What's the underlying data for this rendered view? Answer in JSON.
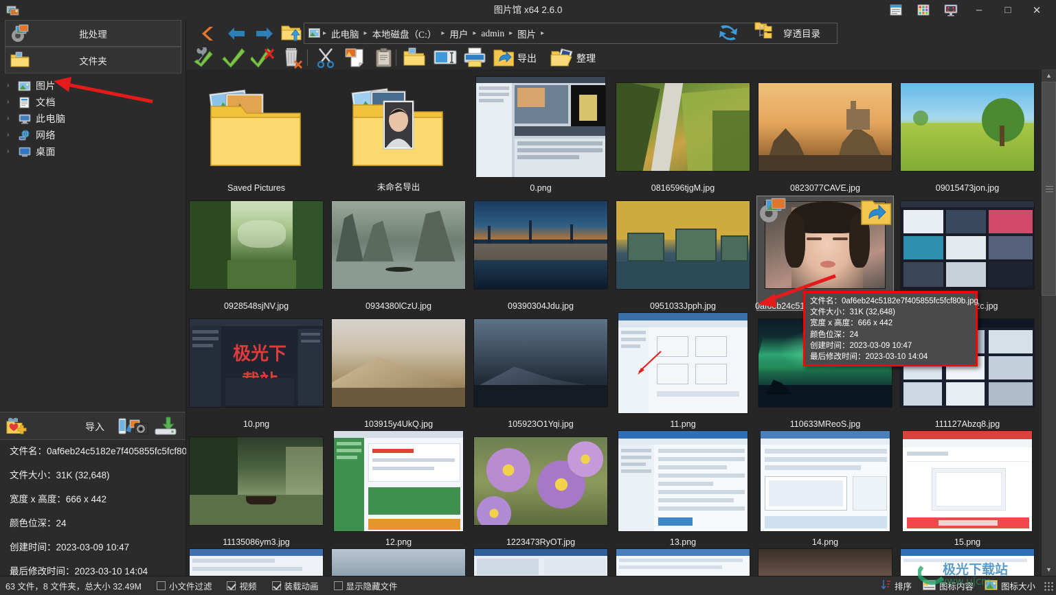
{
  "window": {
    "title": "图片馆 x64 2.6.0",
    "app_icon": "photo-library-icon",
    "tray_icons": [
      "document-list-icon",
      "color-palette-icon",
      "screen-capture-icon"
    ],
    "minimize": "–",
    "maximize": "□",
    "close": "✕"
  },
  "left_panel": {
    "batch_label": "批处理",
    "folder_label": "文件夹",
    "tree": [
      {
        "label": "图片",
        "icon": "picture-icon",
        "chevron": "›"
      },
      {
        "label": "文档",
        "icon": "document-icon",
        "chevron": "›"
      },
      {
        "label": "此电脑",
        "icon": "computer-icon",
        "chevron": "›"
      },
      {
        "label": "网络",
        "icon": "network-icon",
        "chevron": "›"
      },
      {
        "label": "桌面",
        "icon": "desktop-icon",
        "chevron": "›"
      }
    ],
    "import_label": "导入",
    "import_icons": [
      "favorites-add-icon",
      "camera-import-icon",
      "disk-import-icon"
    ],
    "info": [
      "文件名：0af6eb24c5182e7f405855fc5fcf80",
      "文件大小：31K (32,648)",
      "宽度 x 高度：666 x 442",
      "颜色位深：24",
      "创建时间：2023-03-09 10:47",
      "最后修改时间：2023-03-10 14:04"
    ]
  },
  "toolbar": {
    "nav": [
      {
        "name": "back-up-icon",
        "glyph": "‹"
      },
      {
        "name": "back-arrow-icon",
        "glyph": "←"
      },
      {
        "name": "forward-arrow-icon",
        "glyph": "→"
      },
      {
        "name": "open-parent-folder-icon",
        "glyph": "↑"
      }
    ],
    "address": {
      "icon": "picture-icon",
      "crumbs": [
        "此电脑",
        "本地磁盘（C:）",
        "用户",
        "admin",
        "图片"
      ],
      "separator": "▸"
    },
    "refresh_icon": "refresh-icon",
    "passthrough_label": "穿透目录",
    "passthrough_icon": "folder-tree-icon",
    "collapse_icon": "collapse-chevron-icon",
    "tools": [
      {
        "name": "settings-check-icon"
      },
      {
        "name": "select-all-icon"
      },
      {
        "name": "deselect-icon"
      },
      {
        "name": "delete-icon"
      },
      {
        "name": "cut-icon"
      },
      {
        "name": "copy-icon"
      },
      {
        "name": "paste-icon"
      },
      {
        "name": "new-folder-icon"
      },
      {
        "name": "rename-icon"
      },
      {
        "name": "print-icon"
      }
    ],
    "export_label": "导出",
    "export_icon": "export-folder-icon",
    "organize_label": "整理",
    "organize_icon": "organize-folder-icon"
  },
  "grid": {
    "rows": [
      [
        {
          "name": "Saved Pictures",
          "type": "folder-stack",
          "tint": "#f0c23c"
        },
        {
          "name": "未命名导出",
          "type": "folder-portrait",
          "tint": "#f0c23c"
        },
        {
          "name": "0.png",
          "type": "screenshot-ui",
          "tint": "#cfd6de"
        },
        {
          "name": "0816596tjgM.jpg",
          "type": "photo-aerial-road",
          "tint": "#6f8d3c"
        },
        {
          "name": "0823077CAVE.jpg",
          "type": "photo-castle-sunset",
          "tint": "#c98a45"
        },
        {
          "name": "09015473jon.jpg",
          "type": "photo-tree-field",
          "tint": "#8fbf4a"
        }
      ],
      [
        {
          "name": "0928548sjNV.jpg",
          "type": "photo-forest-green",
          "tint": "#3f6b33"
        },
        {
          "name": "0934380lCzU.jpg",
          "type": "photo-river-mist",
          "tint": "#6f7d74"
        },
        {
          "name": "09390304Jdu.jpg",
          "type": "photo-bridge-night",
          "tint": "#1d3a5c"
        },
        {
          "name": "0951033Jpph.jpg",
          "type": "photo-pier-yellow",
          "tint": "#c6a33c"
        },
        {
          "name": "0af6eb24c5182e7f405855fc5fcf80b.jpg",
          "type": "photo-portrait",
          "tint": "#6b5a54",
          "selected": true
        },
        {
          "name": "0b0e4d1b2c.jpg",
          "type": "screenshot-dark-ui",
          "tint": "#2a2a35"
        }
      ],
      [
        {
          "name": "10.png",
          "type": "screenshot-red-text",
          "tint": "#1f2430"
        },
        {
          "name": "103915y4UkQ.jpg",
          "type": "photo-sand-dune",
          "tint": "#b99e7c"
        },
        {
          "name": "105923O1Yqi.jpg",
          "type": "photo-dune-night",
          "tint": "#2c3440"
        },
        {
          "name": "11.png",
          "type": "screenshot-blue-ui",
          "tint": "#dfe6ee"
        },
        {
          "name": "110633MReoS.jpg",
          "type": "photo-aurora",
          "tint": "#1b4636"
        },
        {
          "name": "111127Abzq8.jpg",
          "type": "screenshot-win-ui",
          "tint": "#2a2f3c"
        }
      ],
      [
        {
          "name": "11135086ym3.jpg",
          "type": "photo-lake-boat",
          "tint": "#4a5f46"
        },
        {
          "name": "12.png",
          "type": "screenshot-green-ui",
          "tint": "#e8edf2"
        },
        {
          "name": "1223473RyOT.jpg",
          "type": "photo-purple-flowers",
          "tint": "#9b7ec4"
        },
        {
          "name": "13.png",
          "type": "screenshot-form-ui",
          "tint": "#eef2f6"
        },
        {
          "name": "14.png",
          "type": "screenshot-list-ui",
          "tint": "#f0f3f7"
        },
        {
          "name": "15.png",
          "type": "screenshot-pdf-ui",
          "tint": "#f4f6f9"
        }
      ]
    ]
  },
  "tooltip": {
    "border_color": "#ff0000",
    "lines": [
      "文件名：0af6eb24c5182e7f405855fc5fcf80b.jpg",
      "文件大小：31K (32,648)",
      "宽度 x 高度：666 x 442",
      "颜色位深：24",
      "创建时间：2023-03-09 10:47",
      "最后修改时间：2023-03-10 14:04"
    ]
  },
  "statusbar": {
    "summary": "63 文件，8 文件夹，总大小 32.49M",
    "checkboxes": [
      {
        "label": "小文件过滤",
        "checked": false
      },
      {
        "label": "视频",
        "checked": true
      },
      {
        "label": "装载动画",
        "checked": true
      },
      {
        "label": "显示隐藏文件",
        "checked": false
      }
    ],
    "sort_label": "排序",
    "sort_icon": "sort-descending-icon",
    "icon_content_label": "图标内容",
    "icon_content_icon": "icon-content-icon",
    "icon_size_label": "图标大小",
    "icon_size_icon": "icon-size-icon"
  },
  "annotations": {
    "arrow_color": "#e51b1b",
    "arrows": [
      "sidebar-pictures-arrow",
      "selected-thumbnail-arrow"
    ]
  },
  "colors": {
    "background": "#2b2b2b",
    "content_bg": "#262626",
    "accent_orange": "#e8772a",
    "accent_blue": "#2e7fb8",
    "selection": "#4c4c4c",
    "tooltip_bg": "#4a4a4a",
    "text": "#ededed"
  }
}
